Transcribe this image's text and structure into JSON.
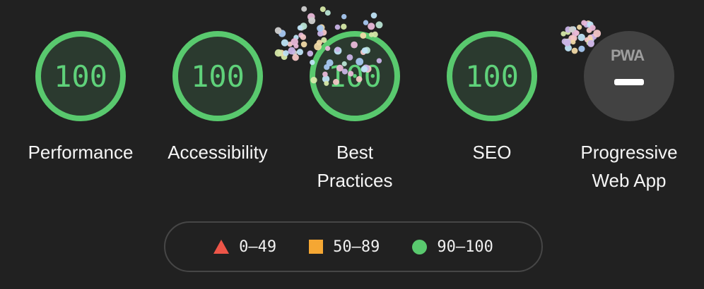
{
  "gauges": [
    {
      "score": "100",
      "label": "Performance"
    },
    {
      "score": "100",
      "label": "Accessibility"
    },
    {
      "score": "100",
      "label_line1": "Best",
      "label_line2": "Practices"
    },
    {
      "score": "100",
      "label": "SEO"
    }
  ],
  "pwa": {
    "badge": "PWA",
    "label_line1": "Progressive",
    "label_line2": "Web App"
  },
  "legend": {
    "fail": "0–49",
    "average": "50–89",
    "pass": "90–100",
    "colors": {
      "fail": "#ed5548",
      "average": "#f5a733",
      "pass": "#59c96e"
    }
  },
  "colors": {
    "background": "#212121",
    "gauge_ring": "#59c96e",
    "gauge_text": "#5fd17a",
    "pwa_fill": "#424242"
  }
}
